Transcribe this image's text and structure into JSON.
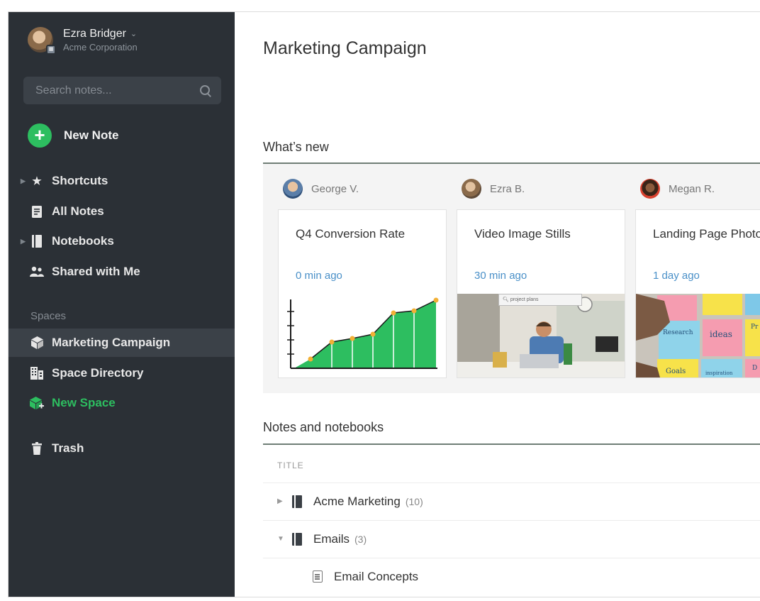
{
  "account": {
    "name": "Ezra Bridger",
    "org": "Acme Corporation",
    "chevron": "⌄"
  },
  "search": {
    "placeholder": "Search notes..."
  },
  "new_note": {
    "label": "New Note",
    "icon": "plus-icon"
  },
  "sidebar": {
    "items": [
      {
        "label": "Shortcuts",
        "icon": "star-icon"
      },
      {
        "label": "All Notes",
        "icon": "note-icon"
      },
      {
        "label": "Notebooks",
        "icon": "notebook-icon"
      },
      {
        "label": "Shared with Me",
        "icon": "people-icon"
      }
    ],
    "spaces_heading": "Spaces",
    "spaces": [
      {
        "label": "Marketing Campaign",
        "icon": "cube-icon"
      },
      {
        "label": "Space Directory",
        "icon": "building-icon"
      },
      {
        "label": "New Space",
        "icon": "new-space-icon"
      }
    ],
    "trash": {
      "label": "Trash",
      "icon": "trash-icon"
    }
  },
  "main": {
    "title": "Marketing Campaign",
    "whats_new": {
      "heading": "What’s new",
      "cards": [
        {
          "author": "George V.",
          "title": "Q4 Conversion Rate",
          "time": "0 min ago"
        },
        {
          "author": "Ezra B.",
          "title": "Video Image Stills",
          "time": "30 min ago",
          "search_text": "project plans"
        },
        {
          "author": "Megan R.",
          "title": "Landing Page Photos",
          "time": "1 day ago",
          "sticky_notes": [
            "Research",
            "ideas",
            "Goals",
            "inspiration",
            "Pr",
            "D"
          ]
        }
      ]
    },
    "notes": {
      "heading": "Notes and notebooks",
      "column_title": "TITLE",
      "rows": [
        {
          "caret": "▶",
          "label": "Acme Marketing",
          "count": "(10)"
        },
        {
          "caret": "▼",
          "label": "Emails",
          "count": "(3)"
        },
        {
          "label": "Email Concepts"
        }
      ]
    }
  },
  "colors": {
    "sidebar_bg": "#2b3036",
    "accent_green": "#2dbe60",
    "link_blue": "#4a90c8"
  }
}
